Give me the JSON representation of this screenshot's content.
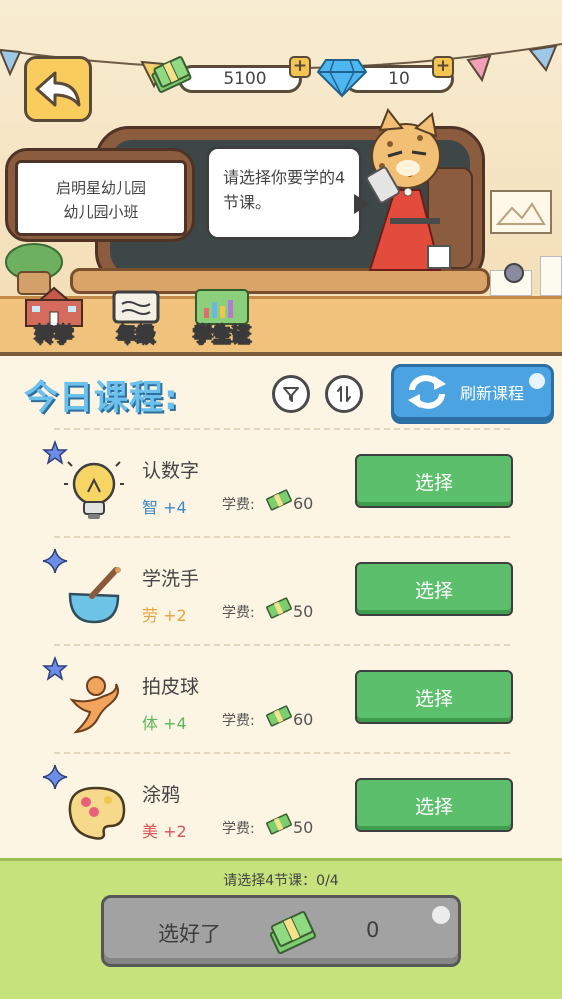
{
  "header": {
    "back_icon": "back-arrow-icon",
    "money": "5100",
    "gems": "10",
    "money_icon": "cash-stack-icon",
    "gem_icon": "diamond-icon",
    "plus": "+"
  },
  "school": {
    "name": "启明星幼儿园",
    "class": "幼儿园小班"
  },
  "speech": "请选择你要学的4节课。",
  "nav": [
    {
      "label": "转学",
      "icon": "school-building-icon"
    },
    {
      "label": "年级",
      "icon": "grade-book-icon"
    },
    {
      "label": "学生证",
      "icon": "student-card-icon"
    }
  ],
  "courses_panel": {
    "title": "今日课程:",
    "filter_icon": "filter-icon",
    "sort_icon": "sort-icon",
    "refresh_label": "刷新课程",
    "refresh_icon": "refresh-icon",
    "fee_label": "学费:",
    "select_label": "选择"
  },
  "courses": [
    {
      "name": "认数字",
      "attr": "智 +4",
      "fee": "60",
      "icon": "lightbulb-icon",
      "star": "star-icon",
      "attr_color": "#3d86c8"
    },
    {
      "name": "学洗手",
      "attr": "劳 +2",
      "fee": "50",
      "icon": "soap-brush-icon",
      "star": "sparkle-icon",
      "attr_color": "#e8a23c"
    },
    {
      "name": "拍皮球",
      "attr": "体 +4",
      "fee": "60",
      "icon": "running-person-icon",
      "star": "star-icon",
      "attr_color": "#5bb85c"
    },
    {
      "name": "涂鸦",
      "attr": "美 +2",
      "fee": "50",
      "icon": "paint-palette-icon",
      "star": "sparkle-icon",
      "attr_color": "#e0525a"
    }
  ],
  "footer": {
    "status": "请选择4节课：0/4",
    "confirm_label": "选好了",
    "cost": "0"
  },
  "colors": {
    "title_blue": "#6bc0ec",
    "select_green": "#5cbf6b",
    "refresh_blue": "#4ba3e2",
    "bottom_green": "#c6e27c"
  }
}
